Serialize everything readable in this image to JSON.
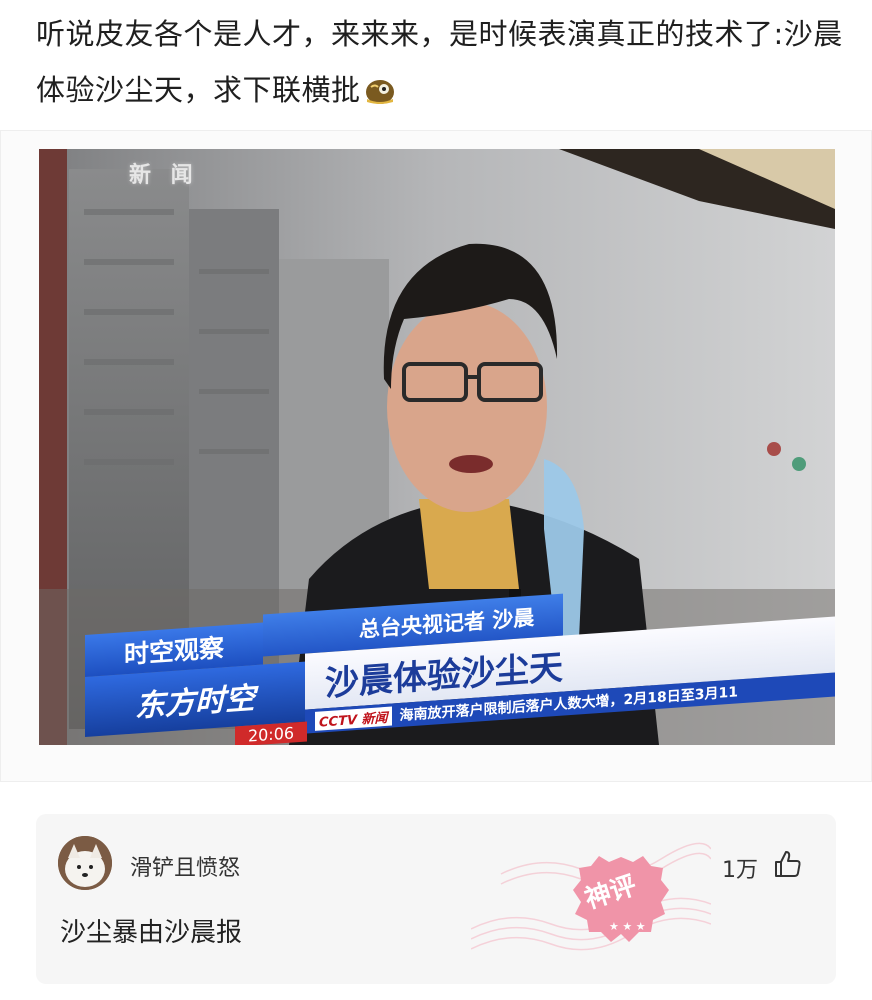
{
  "post": {
    "title": "听说皮友各个是人才，来来来，是时候表演真正的技术了:沙晨体验沙尘天，求下联横批",
    "emoji_icon": "smug-face-emoji-icon"
  },
  "image": {
    "channel_logo": "新 闻",
    "banner_label1": "时空观察",
    "banner_label2": "东方时空",
    "reporter": "总台央视记者 沙晨",
    "headline": "沙晨体验沙尘天",
    "ticker_logo": "CCTV 新闻",
    "ticker": "海南放开落户限制后落户人数大增，2月18日至3月11",
    "time": "20:06"
  },
  "comment": {
    "username": "滑铲且愤怒",
    "like_count": "1万",
    "text": "沙尘暴由沙晨报",
    "stamp_label": "神评"
  },
  "colors": {
    "banner_blue": "#2356c7",
    "headline_blue": "#1c3c9a",
    "stamp_pink": "#f08aa0",
    "card_bg": "#f6f6f6"
  }
}
